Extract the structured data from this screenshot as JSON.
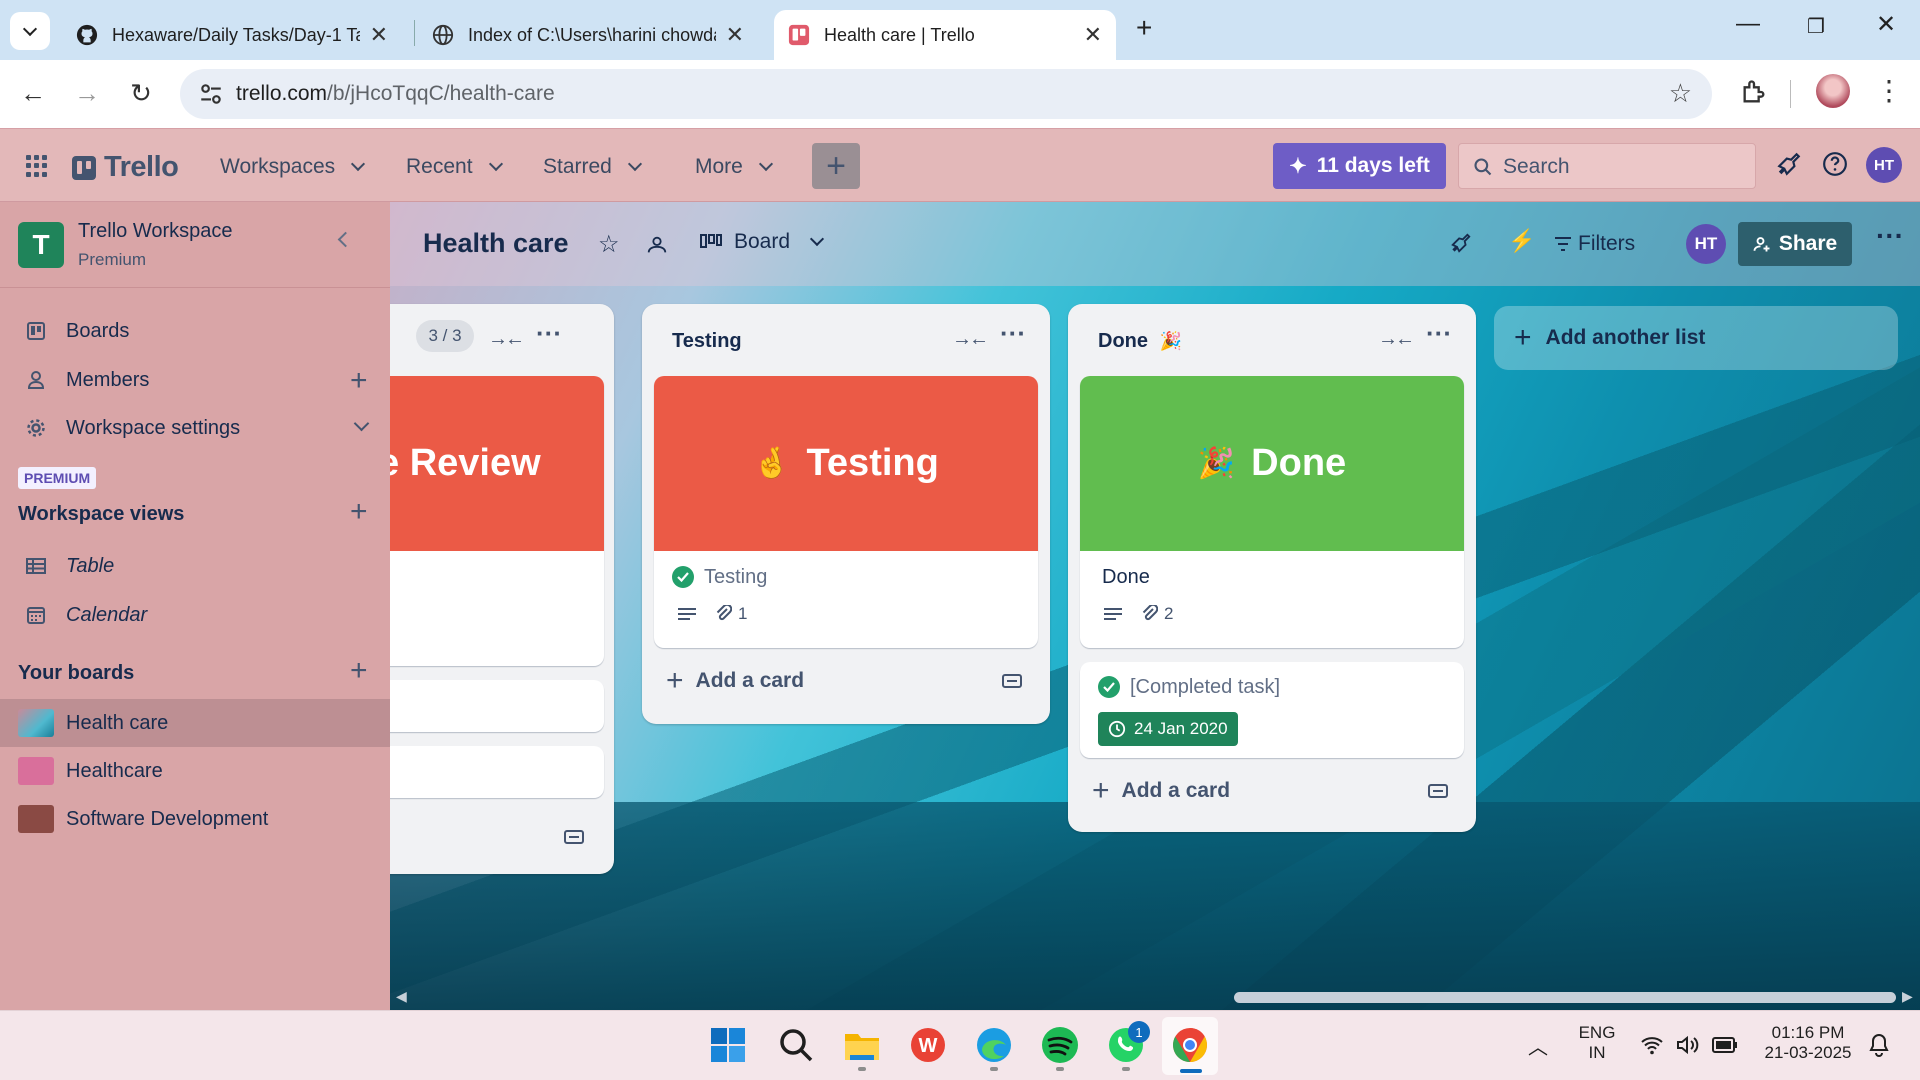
{
  "browser": {
    "tabs": [
      {
        "title": "Hexaware/Daily Tasks/Day-1 Ta",
        "icon": "github-icon"
      },
      {
        "title": "Index of C:\\Users\\harini chowda",
        "icon": "globe-icon"
      },
      {
        "title": "Health care | Trello",
        "icon": "trello-icon",
        "active": true
      }
    ],
    "url_host": "trello.com",
    "url_path": "/b/jHcoTqqC/health-care"
  },
  "header": {
    "logo": "Trello",
    "menu": [
      "Workspaces",
      "Recent",
      "Starred",
      "More"
    ],
    "create_label": "+",
    "trial_label": "11 days left",
    "search_placeholder": "Search",
    "avatar_initials": "HT"
  },
  "sidebar": {
    "workspace_name": "Trello Workspace",
    "workspace_plan": "Premium",
    "workspace_initial": "T",
    "items": [
      {
        "label": "Boards",
        "icon": "boards-icon"
      },
      {
        "label": "Members",
        "icon": "members-icon"
      },
      {
        "label": "Workspace settings",
        "icon": "gear-icon"
      }
    ],
    "premium_badge": "PREMIUM",
    "views_heading": "Workspace views",
    "views": [
      {
        "label": "Table",
        "icon": "table-icon"
      },
      {
        "label": "Calendar",
        "icon": "calendar-icon"
      }
    ],
    "boards_heading": "Your boards",
    "boards": [
      {
        "label": "Health care",
        "active": true
      },
      {
        "label": "Healthcare"
      },
      {
        "label": "Software Development"
      }
    ]
  },
  "board": {
    "title": "Health care",
    "view": "Board",
    "filters": "Filters",
    "member_initials": "HT",
    "share": "Share",
    "lists": [
      {
        "title": "",
        "count": "3 / 3",
        "cover_text": "e Review",
        "add_card": ""
      },
      {
        "title": "Testing",
        "cover_emoji": "🤞",
        "cover_text": "Testing",
        "card_title": "Testing",
        "attachments": "1",
        "add_card": "Add a card"
      },
      {
        "title": "Done",
        "title_emoji": "🎉",
        "cover_emoji": "🎉",
        "cover_text": "Done",
        "card_title": "Done",
        "attachments": "2",
        "card2_title": "[Completed task]",
        "card2_due": "24 Jan 2020",
        "add_card": "Add a card"
      }
    ],
    "add_list": "Add another list"
  },
  "taskbar": {
    "language": "ENG",
    "region": "IN",
    "time": "01:16 PM",
    "date": "21-03-2025",
    "whatsapp_badge": "1"
  },
  "colors": {
    "header_bg": "#e3b8b9",
    "sidebar_bg": "#d9a5a7",
    "trial_purple": "#6e5dc6",
    "cover_red": "#eb5a46",
    "cover_green": "#61bd4f",
    "due_green": "#1f845a"
  }
}
